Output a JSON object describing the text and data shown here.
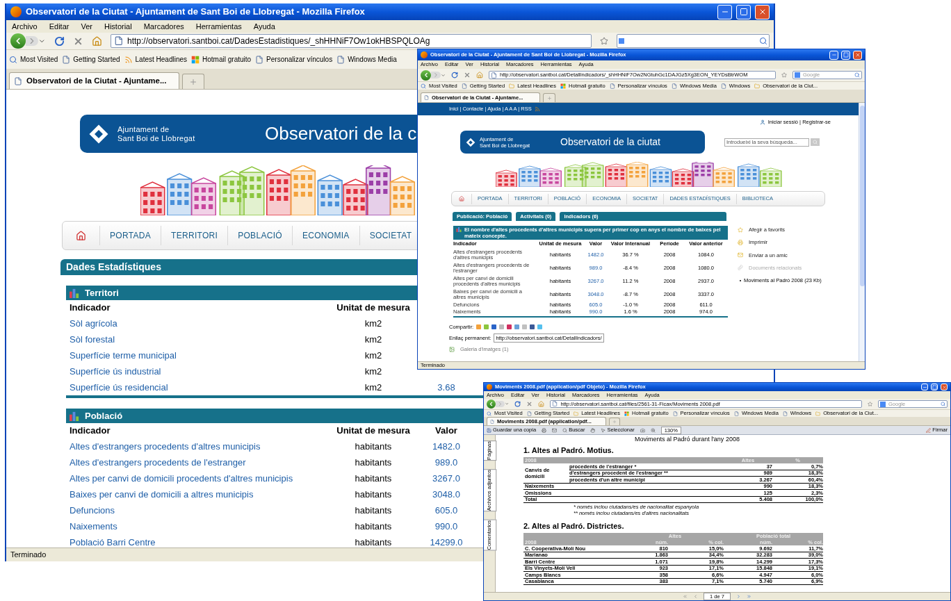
{
  "main_window": {
    "browser": {
      "title": "Observatori de la Ciutat - Ajuntament de Sant Boi de Llobregat - Mozilla Firefox",
      "menu": [
        "Archivo",
        "Editar",
        "Ver",
        "Historial",
        "Marcadores",
        "Herramientas",
        "Ayuda"
      ],
      "url": "http://observatori.santboi.cat/DadesEstadistiques/_shHHNiF7Ow1okHBSPQLOAg",
      "bookmarks": [
        {
          "label": "Most Visited",
          "kind": "search"
        },
        {
          "label": "Getting Started",
          "kind": "page"
        },
        {
          "label": "Latest Headlines",
          "kind": "feed"
        },
        {
          "label": "Hotmail gratuito",
          "kind": "flag"
        },
        {
          "label": "Personalizar vínculos",
          "kind": "page"
        },
        {
          "label": "Windows Media",
          "kind": "page"
        }
      ],
      "tab": "Observatori de la Ciutat - Ajuntame..."
    },
    "page": {
      "org": [
        "Ajuntament de",
        "Sant Boi de Llobregat"
      ],
      "title": "Observatori de la c",
      "nav": [
        "PORTADA",
        "TERRITORI",
        "POBLACIÓ",
        "ECONOMIA",
        "SOCIETAT"
      ],
      "section": "Dades Estadístiques",
      "groups": [
        {
          "title": "Territori",
          "columns": [
            "Indicador",
            "Unitat de mesura"
          ],
          "rows": [
            {
              "indicator": "Sòl agrícola",
              "unit": "km2"
            },
            {
              "indicator": "Sòl forestal",
              "unit": "km2"
            },
            {
              "indicator": "Superfície terme municipal",
              "unit": "km2"
            },
            {
              "indicator": "Superfície ús industrial",
              "unit": "km2"
            },
            {
              "indicator": "Superfície ús residencial",
              "unit": "km2",
              "value": "3.68"
            }
          ]
        },
        {
          "title": "Població",
          "columns": [
            "Indicador",
            "Unitat de mesura",
            "Valor"
          ],
          "rows": [
            {
              "indicator": "Altes d'estrangers procedents d'altres municipis",
              "unit": "habitants",
              "value": "1482.0"
            },
            {
              "indicator": "Altes d'estrangers procedents de l'estranger",
              "unit": "habitants",
              "value": "989.0"
            },
            {
              "indicator": "Altes per canvi de domicili procedents d'altres municipis",
              "unit": "habitants",
              "value": "3267.0"
            },
            {
              "indicator": "Baixes per canvi de domicili a altres municipis",
              "unit": "habitants",
              "value": "3048.0"
            },
            {
              "indicator": "Defuncions",
              "unit": "habitants",
              "value": "605.0"
            },
            {
              "indicator": "Naixements",
              "unit": "habitants",
              "value": "990.0"
            },
            {
              "indicator": "Població Barri Centre",
              "unit": "habitants",
              "value": "14299.0"
            }
          ]
        }
      ]
    },
    "status": "Terminado"
  },
  "detail_window": {
    "browser": {
      "title": "Observatori de la Ciutat - Ajuntament de Sant Boi de Llobregat - Mozilla Firefox",
      "menu": [
        "Archivo",
        "Editar",
        "Ver",
        "Historial",
        "Marcadores",
        "Herramientas",
        "Ayuda"
      ],
      "url": "http://observatori.santboi.cat/DetallIndicadors/_shHHNiF7Ow2NGtuhGc1DAJGz5Xg3EON_YEYDsBtrWOM",
      "search_placeholder": "Google",
      "bookmarks": [
        {
          "label": "Most Visited",
          "kind": "search"
        },
        {
          "label": "Getting Started",
          "kind": "page"
        },
        {
          "label": "Latest Headlines",
          "kind": "folder"
        },
        {
          "label": "Hotmail gratuito",
          "kind": "flag"
        },
        {
          "label": "Personalizar vínculos",
          "kind": "page"
        },
        {
          "label": "Windows Media",
          "kind": "page"
        },
        {
          "label": "Windows",
          "kind": "page"
        },
        {
          "label": "Observatori de la Ciut...",
          "kind": "folder"
        }
      ],
      "tab": "Observatori de la Ciutat - Ajuntame..."
    },
    "page": {
      "utility": "Inici | Contacte | Ajuda | A A A | RSS",
      "login": "Iniciar sessió | Registrar-se",
      "org": [
        "Ajuntament de",
        "Sant Boi de Llobregat"
      ],
      "title": "Observatori de la ciutat",
      "search_placeholder": "Introdueixi la seva búsqueda...",
      "nav": [
        "PORTADA",
        "TERRITORI",
        "POBLACIÓ",
        "ECONOMIA",
        "SOCIETAT",
        "DADES ESTADÍSTIQUES",
        "BIBLIOTECA"
      ],
      "tabs": [
        "Publicació: Població",
        "Activitats (0)",
        "Indicadors (6)"
      ],
      "headline": "El nombre d'altes procedents d'altres municipis supera per primer cop en anys el nombre de baixes pel mateix concepte.",
      "columns": [
        "Indicador",
        "Unitat de mesura",
        "Valor",
        "Valor Interanual",
        "Període",
        "Valor anterior"
      ],
      "rows": [
        {
          "indicator": "Altes d'estrangers procedents d'altres municipis",
          "unit": "habitants",
          "value": "1482.0",
          "yoy": "36.7 %",
          "period": "2008",
          "previous": "1084.0"
        },
        {
          "indicator": "Altes d'estrangers procedents de l'estranger",
          "unit": "habitants",
          "value": "989.0",
          "yoy": "-8.4 %",
          "period": "2008",
          "previous": "1080.0"
        },
        {
          "indicator": "Altes per canvi de domicili procedents d'altres municipis",
          "unit": "habitants",
          "value": "3267.0",
          "yoy": "11.2 %",
          "period": "2008",
          "previous": "2937.0"
        },
        {
          "indicator": "Baixes per canvi de domicili a altres municipis",
          "unit": "habitants",
          "value": "3048.0",
          "yoy": "-8.7 %",
          "period": "2008",
          "previous": "3337.0"
        },
        {
          "indicator": "Defuncions",
          "unit": "habitants",
          "value": "605.0",
          "yoy": "-1.0 %",
          "period": "2008",
          "previous": "611.0"
        },
        {
          "indicator": "Naixements",
          "unit": "habitants",
          "value": "990.0",
          "yoy": "1.6 %",
          "period": "2008",
          "previous": "974.0"
        }
      ],
      "share_label": "Compartir:",
      "permalink_label": "Enllaç permanent:",
      "permalink": "http://observatori.santboi.cat/DetallIndicadors/",
      "gallery": "Galeria d'imatges (1)",
      "actions": [
        {
          "label": "Afegir a favorits",
          "kind": "star",
          "disabled": false
        },
        {
          "label": "Imprimir",
          "kind": "print",
          "disabled": false
        },
        {
          "label": "Enviar a un amic",
          "kind": "mail",
          "disabled": false
        },
        {
          "label": "Documents relacionats",
          "kind": "docs",
          "disabled": true
        }
      ],
      "documents": [
        "Moviments al Padró 2008 (23 Kb)"
      ]
    },
    "status": "Terminado"
  },
  "pdf_window": {
    "browser": {
      "title": "Moviments 2008.pdf (application/pdf Objeto) - Mozilla Firefox",
      "menu": [
        "Archivo",
        "Editar",
        "Ver",
        "Historial",
        "Marcadores",
        "Herramientas",
        "Ayuda"
      ],
      "url": "http://observatori.santboi.cat/files/2561-31-Ficax/Moviments 2008.pdf",
      "search_placeholder": "Google",
      "bookmarks": [
        {
          "label": "Most Visited",
          "kind": "search"
        },
        {
          "label": "Getting Started",
          "kind": "page"
        },
        {
          "label": "Latest Headlines",
          "kind": "folder"
        },
        {
          "label": "Hotmail gratuito",
          "kind": "flag"
        },
        {
          "label": "Personalizar vínculos",
          "kind": "page"
        },
        {
          "label": "Windows Media",
          "kind": "page"
        },
        {
          "label": "Windows",
          "kind": "page"
        },
        {
          "label": "Observatori de la Ciut...",
          "kind": "folder"
        }
      ],
      "tab": "Moviments 2008.pdf (application/pdf..."
    },
    "toolbar": {
      "save": "Guardar una copia",
      "find": "Buscar",
      "select": "Seleccionar",
      "zoom": "130%",
      "sign": "Firmar"
    },
    "side_tabs": [
      "Páginas",
      "Archivos adjuntos",
      "Comentarios"
    ],
    "doc": {
      "heading": "Moviments al Padró durant l'any 2008",
      "section1": "1. Altes al Padró. Motius.",
      "table1": {
        "columns": [
          "2008",
          "Altes",
          "%"
        ],
        "group": {
          "label": "Canvis de domicili",
          "rows": [
            {
              "label": "procedents de l'estranger *",
              "count": "37",
              "pct": "0,7%"
            },
            {
              "label": "d'estrangers procedent de l'estranger **",
              "count": "989",
              "pct": "18,3%"
            },
            {
              "label": "procedents d'un altre municipi",
              "count": "3.267",
              "pct": "60,4%"
            }
          ]
        },
        "rows": [
          {
            "label": "Naixements",
            "count": "990",
            "pct": "18,3%"
          },
          {
            "label": "Omissions",
            "count": "125",
            "pct": "2,3%"
          },
          {
            "label": "Total",
            "count": "5.408",
            "pct": "100,0%"
          }
        ]
      },
      "notes": [
        "* només inclou ciutadans/es de nacionalitat espanyola",
        "** només inclou ciutadans/es d'altres nacionalitats"
      ],
      "section2": "2. Altes al Padró. Districtes.",
      "table2": {
        "groups": [
          "Altes",
          "Població total"
        ],
        "columns": [
          "2008",
          "núm.",
          "% col.",
          "núm.",
          "% col."
        ],
        "rows": [
          {
            "district": "C. Cooperativa-Molí Nou",
            "altes": "810",
            "altes_pct": "15,0%",
            "pop": "9.692",
            "pop_pct": "11,7%"
          },
          {
            "district": "Marianao",
            "altes": "1.863",
            "altes_pct": "34,4%",
            "pop": "32.283",
            "pop_pct": "39,0%"
          },
          {
            "district": "Barri Centre",
            "altes": "1.071",
            "altes_pct": "19,8%",
            "pop": "14.299",
            "pop_pct": "17,3%"
          },
          {
            "district": "Els Vinyets-Molí Vell",
            "altes": "923",
            "altes_pct": "17,1%",
            "pop": "15.848",
            "pop_pct": "19,1%"
          },
          {
            "district": "Camps Blancs",
            "altes": "358",
            "altes_pct": "6,6%",
            "pop": "4.947",
            "pop_pct": "6,0%"
          },
          {
            "district": "Casablanca",
            "altes": "383",
            "altes_pct": "7,1%",
            "pop": "5.740",
            "pop_pct": "6,9%"
          }
        ]
      }
    },
    "page_field": "1 de 7"
  }
}
